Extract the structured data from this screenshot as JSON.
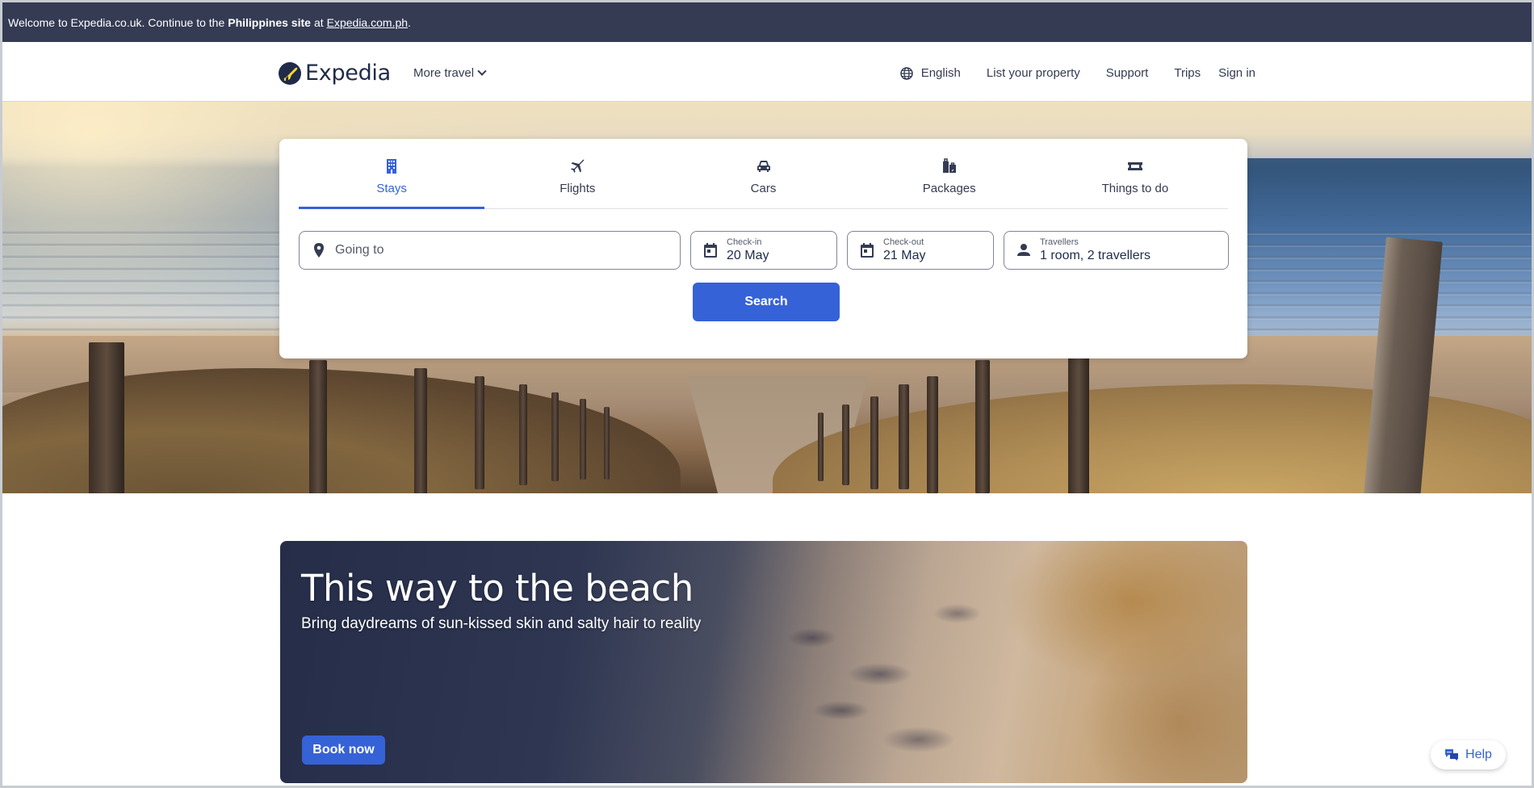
{
  "banner": {
    "text_prefix": "Welcome to Expedia.co.uk. Continue to the",
    "bold": "Philippines site",
    "text_mid": "at",
    "link": "Expedia.com.ph",
    "suffix": "."
  },
  "header": {
    "logo_text": "Expedia",
    "more_travel": "More travel",
    "nav": {
      "language": "English",
      "list_property": "List your property",
      "support": "Support",
      "trips": "Trips",
      "sign_in": "Sign in"
    }
  },
  "search": {
    "tabs": [
      {
        "label": "Stays",
        "icon": "building-icon",
        "active": true
      },
      {
        "label": "Flights",
        "icon": "plane-icon",
        "active": false
      },
      {
        "label": "Cars",
        "icon": "car-icon",
        "active": false
      },
      {
        "label": "Packages",
        "icon": "luggage-icon",
        "active": false
      },
      {
        "label": "Things to do",
        "icon": "ticket-icon",
        "active": false
      }
    ],
    "going_to_placeholder": "Going to",
    "checkin": {
      "label": "Check-in",
      "value": "20 May"
    },
    "checkout": {
      "label": "Check-out",
      "value": "21 May"
    },
    "travellers": {
      "label": "Travellers",
      "value": "1 room, 2 travellers"
    },
    "search_label": "Search"
  },
  "promo": {
    "title": "This way to the beach",
    "subtitle": "Bring daydreams of sun-kissed skin and salty hair to reality",
    "cta": "Book now"
  },
  "help": {
    "label": "Help"
  },
  "colors": {
    "brand_navy": "#1f2b49",
    "banner_bg": "#343b53",
    "accent_blue": "#3662d8",
    "logo_yellow": "#fddb32"
  }
}
